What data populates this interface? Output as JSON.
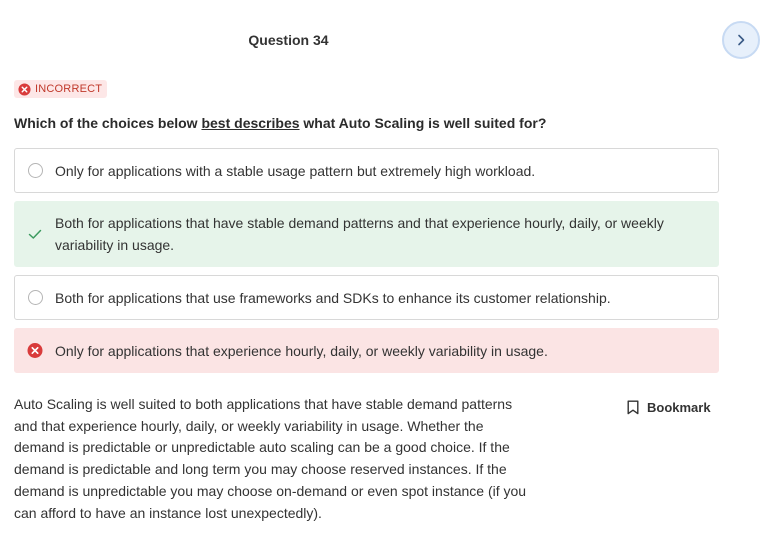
{
  "header": {
    "question_title": "Question 34"
  },
  "navigation": {
    "next_icon": "chevron-right-icon"
  },
  "status": {
    "label": "INCORRECT",
    "icon": "x-circle-icon",
    "color": "#c0392b"
  },
  "question": {
    "prefix": "Which of the choices below ",
    "emphasis": "best describes",
    "suffix": " what Auto Scaling is well suited for?"
  },
  "options": [
    {
      "text": "Only for applications with a stable usage pattern but extremely high workload.",
      "state": "unselected"
    },
    {
      "text": "Both for applications that have stable demand patterns and that experience hourly, daily, or weekly variability in usage.",
      "state": "correct"
    },
    {
      "text": "Both for applications that use frameworks and SDKs to enhance its customer relationship.",
      "state": "unselected"
    },
    {
      "text": "Only for applications that experience hourly, daily, or weekly variability in usage.",
      "state": "incorrect-selected"
    }
  ],
  "explanation": {
    "text": "Auto Scaling is well suited to both applications that have stable demand patterns and that experience hourly, daily, or weekly variability in usage. Whether the demand is predictable or unpredictable auto scaling can be a good choice. If the demand is predictable and long term you may choose reserved instances. If the demand is unpredictable you may choose on-demand or even spot instance (if you can afford to have an instance lost unexpectedly)."
  },
  "bookmark": {
    "label": "Bookmark",
    "icon": "bookmark-icon"
  },
  "colors": {
    "correct_bg": "#e6f4ea",
    "correct_check": "#3c9a5f",
    "wrong_bg": "#fbe4e4",
    "wrong_icon": "#d93b3b",
    "next_button_bg": "#e7f0fb"
  }
}
